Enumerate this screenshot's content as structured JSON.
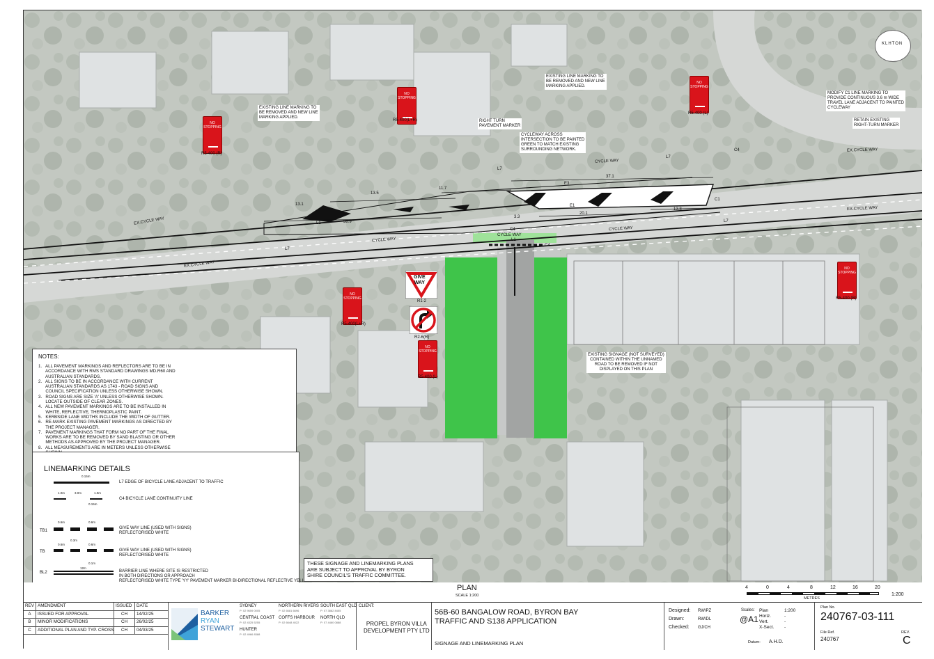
{
  "north_label": "KLHTON",
  "callouts": {
    "c1": "EXISTING LINE MARKING TO\nBE REMOVED AND NEW LINE\nMARKING APPLIED.",
    "c2": "RIGHT TURN\nPAVEMENT MARKER",
    "c3": "CYCLEWAY ACROSS\nINTERSECTION TO BE PAINTED\nGREEN TO MATCH EXISTING\nSURROUNDING NETWORK.",
    "c4": "EXISTING LINE MARKING TO\nBE REMOVED AND NEW LINE\nMARKING APPLIED.",
    "c5": "MODIFY C1 LINE MARKING TO\nPROVIDE CONTINUOUS 3.6 m WIDE\nTRAVEL LANE ADJACENT TO PAINTED\nCYCLEWAY",
    "c6": "RETAIN EXISTING\nRIGHT-TURN MARKER",
    "c7": "EXISTING SIGNAGE (NOT SURVEYED)\nCONTAINED WITHIN THE UNNAMED\nROAD TO BE REMOVED IF NOT\nDISPLAYED ON THIS PLAN"
  },
  "signs": {
    "ns_text": "NO\nSTOPPING",
    "labels": [
      "R5-400 (R)",
      "R5-400(L+R)",
      "R5-400 (L)",
      "R5-400(L+R)",
      "R5-400 (L)",
      "R5-400 (R)"
    ],
    "give_way": "GIVE\nWAY",
    "give_way_code": "R1-2",
    "no_right_code": "R2-6(R)"
  },
  "dims": [
    "13.5",
    "11.7",
    "37.1",
    "38.9",
    "20.1",
    "13.8",
    "3.3",
    "13.1",
    "3.5",
    "3.5",
    "3.5",
    "3.6",
    "3.6",
    "1.5",
    "1.5",
    "1.5",
    "3.5",
    "3.5"
  ],
  "road_labels": [
    "EX.CYCLE WAY",
    "CYCLE WAY",
    "EX.CYCLE WAY",
    "CYCLE WAY",
    "EX.CYCLE WAY",
    "CYCLE WAY",
    "EX.CYCLE WAY",
    "CYCLE WAY"
  ],
  "line_codes": [
    "L7",
    "L7",
    "L7",
    "L7",
    "L1",
    "C4",
    "C1",
    "C4",
    "E1",
    "E3",
    "C4",
    "L1"
  ],
  "notes": {
    "title": "NOTES:",
    "items": [
      "1.   ALL PAVEMENT MARKINGS AND REFLECTORS ARE TO BE IN\n      ACCORDANCE WITH RMS STANDARD DRAWINGS MD.R60 AND\n      AUSTRALIAN STANDARDS.",
      "2.   ALL SIGNS TO BE IN ACCORDANCE WITH CURRENT\n      AUSTRALIAN STANDARDS AS 1743 - ROAD SIGNS AND\n      COUNCIL SPECIFICATION UNLESS OTHERWISE SHOWN.",
      "3.   ROAD SIGNS ARE SIZE 'A' UNLESS OTHERWISE SHOWN.\n      LOCATE OUTSIDE OF CLEAR ZONES.",
      "4.   ALL NEW PAVEMENT MARKINGS ARE TO BE INSTALLED IN\n      WHITE, REFLECTIVE, THERMOPLASTIC PAINT.",
      "5.   KERBSIDE LANE WIDTHS INCLUDE THE WIDTH OF GUTTER.",
      "6.   RE-MARK EXISTING PAVEMENT MARKINGS AS DIRECTED BY\n      THE PROJECT MANAGER.",
      "7.   PAVEMENT MARKINGS THAT FORM NO PART OF THE FINAL\n      WORKS ARE TO BE REMOVED BY SAND BLASTING OR OTHER\n      METHODS AS APPROVED BY THE PROJECT MANAGER.",
      "8.   ALL MEASUREMENTS ARE IN METERS UNLESS OTHERWISE\n      SHOWN."
    ]
  },
  "linemarking": {
    "title": "LINEMARKING DETAILS",
    "rows": [
      {
        "code": "",
        "dims": [
          "0.15m"
        ],
        "desc": "L7 EDGE OF BICYCLE LANE ADJACENT TO TRAFFIC"
      },
      {
        "code": "",
        "dims": [
          "1.0m",
          "3.0m",
          "1.0m",
          "0.15m"
        ],
        "desc": "C4 BICYCLE LANE CONTINUITY LINE"
      },
      {
        "code": "TB1",
        "dims": [
          "0.6m",
          "0.6m"
        ],
        "desc": "GIVE WAY LINE (USED WITH SIGNS)\nREFLECTORISED WHITE"
      },
      {
        "code": "TB",
        "dims": [
          "0.3m",
          "0.6m",
          "0.6m"
        ],
        "desc": "GIVE WAY LINE (USED WITH SIGNS)\nREFLECTORISED WHITE"
      },
      {
        "code": "BL2",
        "dims": [
          "0.1m",
          "12m"
        ],
        "desc": "BARRIER LINE WHERE SITE IS RESTRICTED\nIN BOTH DIRECTIONS OR APPROACH\nREFLECTORISED WHITE TYPE 'YY' PAVEMENT MARKER BI-DIRECTIONAL REFLECTIVE YELLOW"
      }
    ]
  },
  "approval_note": "THESE SIGNAGE AND LINEMARKING PLANS\nARE SUBJECT TO APPROVAL BY BYRON\nSHIRE COUNCIL'S TRAFFIC COMMITTEE.",
  "plan_title": "PLAN",
  "plan_scale": "SCALE 1:200",
  "scale_bar": {
    "ticks": [
      "4",
      "0",
      "4",
      "8",
      "12",
      "16",
      "20"
    ],
    "unit": "METRES",
    "ratio": "1:200"
  },
  "title_block": {
    "rev_headers": [
      "REV",
      "AMENDMENT",
      "ISSUED",
      "DATE"
    ],
    "revisions": [
      [
        "A",
        "ISSUED FOR APPROVAL",
        "CH",
        "14/02/25"
      ],
      [
        "B",
        "MINOR MODIFICATIONS",
        "CH",
        "26/02/25"
      ],
      [
        "C",
        "ADDITIONAL PLAN AND TYP. CROSS SECTION",
        "CH",
        "04/03/25"
      ]
    ],
    "company": [
      "BARKER",
      "RYAN",
      "STEWART"
    ],
    "offices": [
      {
        "name": "SYDNEY",
        "phone": "P: 02 9659 0005"
      },
      {
        "name": "CENTRAL COAST",
        "phone": "P: 02 4325 5255"
      },
      {
        "name": "HUNTER",
        "phone": "P: 02 4966 8388"
      },
      {
        "name": "NORTHERN RIVERS",
        "phone": "P: 02 6681 6696"
      },
      {
        "name": "COFFS HARBOUR",
        "phone": "P: 02 6648 4022"
      },
      {
        "name": "SOUTH EAST QLD",
        "phone": "P: 07 3882 8455"
      },
      {
        "name": "NORTH QLD",
        "phone": "P: 07 4460 0888"
      }
    ],
    "client_label": "CLIENT:",
    "client": "PROPEL BYRON VILLA\nDEVELOPMENT PTY LTD",
    "project": "56B-60 BANGALOW ROAD, BYRON BAY\nTRAFFIC AND S138 APPLICATION",
    "drawing_title": "SIGNAGE AND LINEMARKING PLAN",
    "designed_label": "Designed:",
    "designed": "RW/PZ",
    "drawn_label": "Drawn:",
    "drawn": "RW/DL",
    "checked_label": "Checked:",
    "checked": "GJ/CH",
    "scales_label": "Scales:",
    "sheet_size": "@A1",
    "plan_label": "Plan",
    "plan_value": "1:200",
    "horiz_label": "Horiz.",
    "horiz_value": "-",
    "vert_label": "Vert.",
    "vert_value": "-",
    "xsect_label": "X-Sect.",
    "xsect_value": "-",
    "datum_label": "Datum:",
    "datum": "A.H.D.",
    "plan_no_label": "Plan No.",
    "plan_no": "240767-03-111",
    "file_ref_label": "File Ref.",
    "file_ref": "240767",
    "rev_label": "REV.",
    "rev": "C"
  },
  "colors": {
    "green": "#3fc44a",
    "sign_red": "#d9141b",
    "tb_blue": "#1d5fa0"
  }
}
